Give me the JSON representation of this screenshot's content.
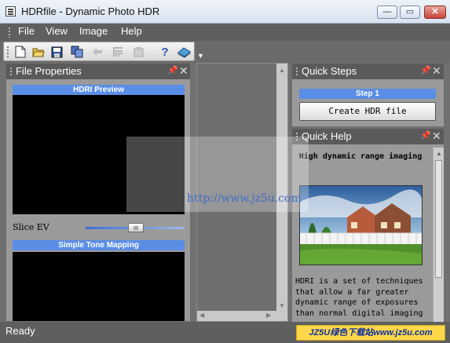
{
  "window": {
    "title": "HDRfile - Dynamic Photo HDR",
    "minimize": "—",
    "maximize": "▭",
    "close": "✕"
  },
  "menu": {
    "items": [
      "File",
      "View",
      "Image",
      "Help"
    ]
  },
  "toolbar": {
    "buttons": [
      "new-file",
      "open-folder",
      "save",
      "copy",
      "back-arrow",
      "tone",
      "layers",
      "help",
      "book"
    ]
  },
  "file_properties": {
    "title": "File Properties",
    "hdri_preview_label": "HDRI Preview",
    "slice_label": "Slice EV",
    "slider_value": 0.5,
    "tone_mapping_label": "Simple Tone Mapping"
  },
  "quick_steps": {
    "title": "Quick Steps",
    "step_label": "Step 1",
    "button_label": "Create HDR file"
  },
  "quick_help": {
    "title": "Quick Help",
    "heading": "High dynamic range imaging",
    "body_lines": [
      "HDRI is a set of techniques",
      "that allow a far greater",
      "dynamic range of exposures",
      "than normal digital imaging"
    ]
  },
  "status": {
    "text": "Ready"
  },
  "watermark": {
    "text": "http://www.jz5u.com"
  },
  "bottom_logo": {
    "text": "JZ5U绿色下载站www.jz5u.com"
  }
}
